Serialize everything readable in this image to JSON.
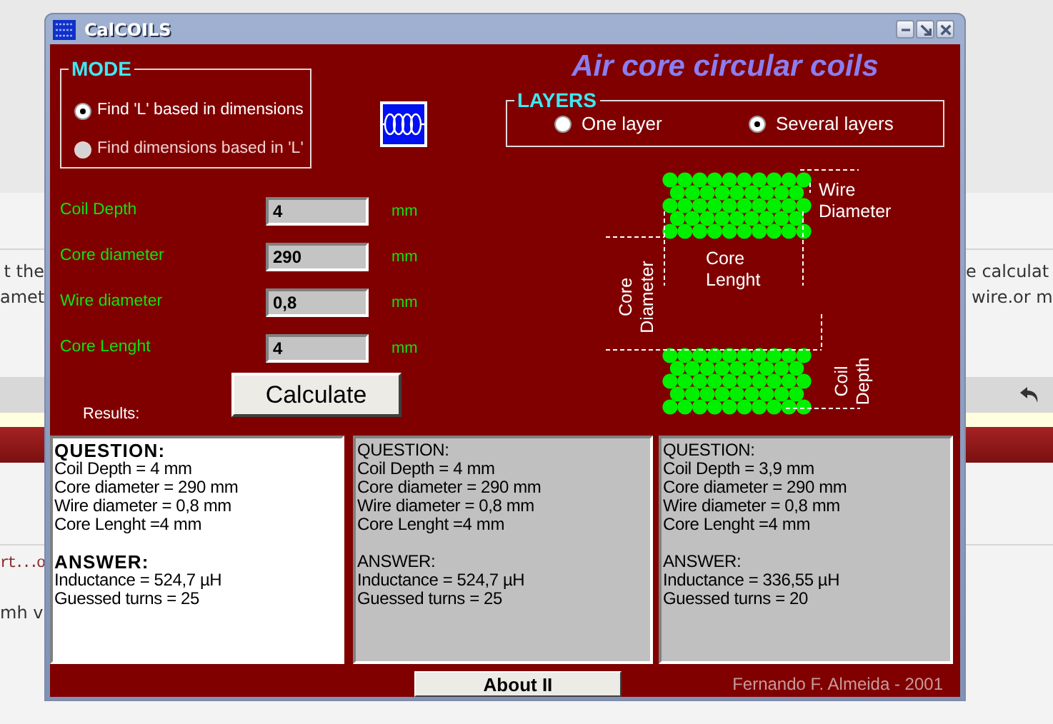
{
  "background_page": {
    "left_lines": [
      "t the",
      "amet"
    ],
    "right_lines": [
      "e calculat",
      "wire.or m"
    ],
    "lower_lines": [
      {
        "kind": "link",
        "text": "rt...o"
      },
      {
        "kind": "plain",
        "text": "mh v"
      }
    ]
  },
  "window": {
    "title": "CalCOILS"
  },
  "mode": {
    "legend": "MODE",
    "options": [
      {
        "label": "Find 'L' based in dimensions",
        "selected": true,
        "disabled": false
      },
      {
        "label": "Find dimensions based in 'L'",
        "selected": false,
        "disabled": true
      }
    ]
  },
  "heading": "Air core circular coils",
  "layers": {
    "legend": "LAYERS",
    "options": [
      {
        "label": "One layer",
        "selected": false
      },
      {
        "label": "Several layers",
        "selected": true
      }
    ]
  },
  "fields": [
    {
      "label": "Coil Depth",
      "value": "4",
      "unit": "mm"
    },
    {
      "label": "Core diameter",
      "value": "290",
      "unit": "mm"
    },
    {
      "label": "Wire diameter",
      "value": "0,8",
      "unit": "mm"
    },
    {
      "label": "Core Lenght",
      "value": "4",
      "unit": "mm"
    }
  ],
  "calculate_button": "Calculate",
  "results_label": "Results:",
  "diagram": {
    "labels": [
      {
        "kind": "wire_diameter",
        "lines": [
          "Wire",
          "Diameter"
        ]
      },
      {
        "kind": "core_length",
        "lines": [
          "Core",
          "Lenght"
        ]
      },
      {
        "kind": "core_diameter",
        "lines": [
          "Core",
          "Diameter"
        ]
      },
      {
        "kind": "coil_depth",
        "lines": [
          "Coil",
          "Depth"
        ]
      }
    ]
  },
  "results": [
    {
      "selected": true,
      "question_heading": "QUESTION:",
      "question_lines": [
        "Coil Depth = 4 mm",
        "Core diameter = 290 mm",
        "Wire diameter = 0,8 mm",
        "Core Lenght =4 mm"
      ],
      "answer_heading": "ANSWER:",
      "answer_lines": [
        "Inductance = 524,7 µH",
        "Guessed turns = 25"
      ]
    },
    {
      "selected": false,
      "question_heading": "QUESTION:",
      "question_lines": [
        "Coil Depth = 4 mm",
        "Core diameter = 290 mm",
        "Wire diameter = 0,8 mm",
        "Core Lenght =4 mm"
      ],
      "answer_heading": "ANSWER:",
      "answer_lines": [
        "Inductance = 524,7 µH",
        "Guessed turns = 25"
      ]
    },
    {
      "selected": false,
      "question_heading": "QUESTION:",
      "question_lines": [
        "Coil Depth = 3,9 mm",
        "Core diameter = 290 mm",
        "Wire diameter = 0,8 mm",
        "Core Lenght =4 mm"
      ],
      "answer_heading": "ANSWER:",
      "answer_lines": [
        "Inductance = 336,55 µH",
        "Guessed turns = 20"
      ]
    }
  ],
  "about_button": "About II",
  "credit": "Fernando F. Almeida - 2001"
}
